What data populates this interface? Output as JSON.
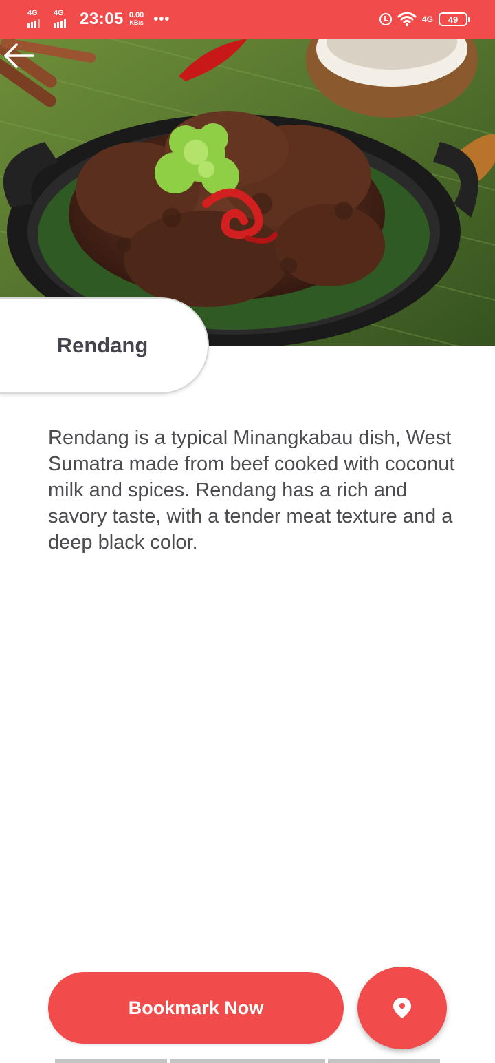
{
  "status_bar": {
    "sim1": "4G",
    "sim2": "4G",
    "time": "23:05",
    "speed_value": "0.00",
    "speed_unit": "KB/s",
    "more": "•••",
    "network_right": "4G",
    "battery": "49"
  },
  "hero": {
    "image": "rendang-dish-photo"
  },
  "detail": {
    "title": "Rendang",
    "description": "Rendang is a typical Minangkabau dish, West Sumatra made from beef cooked with coconut milk and spices. Rendang has a rich and savory taste, with a tender meat texture and a deep black color."
  },
  "actions": {
    "bookmark_label": "Bookmark Now",
    "map_icon": "map-pin-icon"
  },
  "colors": {
    "accent": "#f24b4b",
    "text": "#4b4b50",
    "title": "#44444c"
  }
}
